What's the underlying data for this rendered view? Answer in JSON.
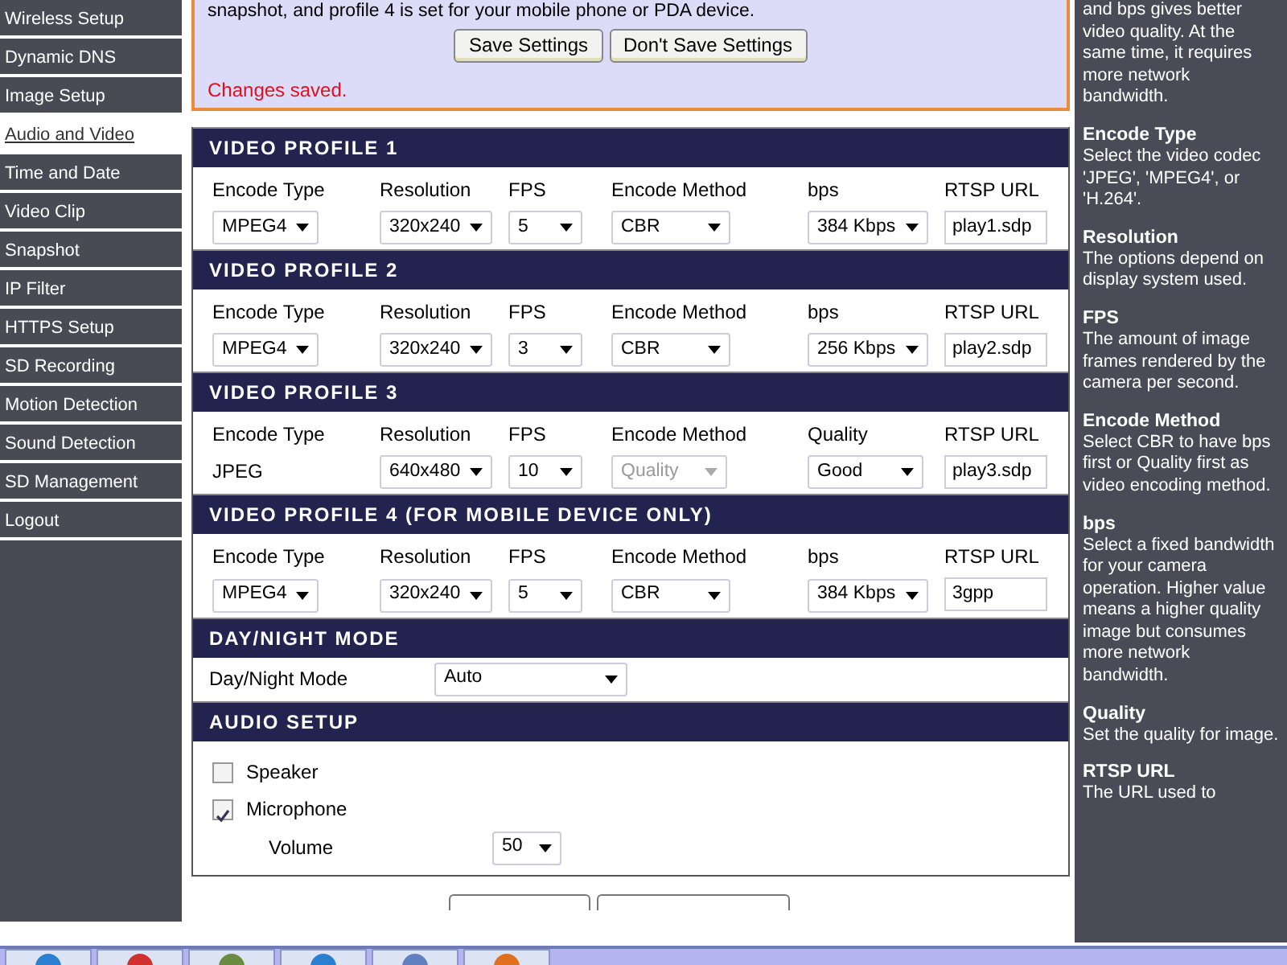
{
  "sidebar": {
    "items": [
      {
        "label": "Wireless Setup",
        "selected": false
      },
      {
        "label": "Dynamic DNS",
        "selected": false
      },
      {
        "label": "Image Setup",
        "selected": false
      },
      {
        "label": "Audio and Video",
        "selected": true
      },
      {
        "label": "Time and Date",
        "selected": false
      },
      {
        "label": "Video Clip",
        "selected": false
      },
      {
        "label": "Snapshot",
        "selected": false
      },
      {
        "label": "IP Filter",
        "selected": false
      },
      {
        "label": "HTTPS Setup",
        "selected": false
      },
      {
        "label": "SD Recording",
        "selected": false
      },
      {
        "label": "Motion Detection",
        "selected": false
      },
      {
        "label": "Sound Detection",
        "selected": false
      },
      {
        "label": "SD Management",
        "selected": false
      },
      {
        "label": "Logout",
        "selected": false
      }
    ]
  },
  "notice": {
    "text": "snapshot, and profile 4 is set for your mobile phone or PDA device.",
    "buttons": [
      "Save Settings",
      "Don't Save Settings"
    ],
    "status": "Changes saved."
  },
  "profiles": [
    {
      "title": "VIDEO PROFILE 1",
      "fields": [
        {
          "label": "Encode Type",
          "kind": "dropdown",
          "value": "MPEG4",
          "disabled": false
        },
        {
          "label": "Resolution",
          "kind": "dropdown",
          "value": "320x240",
          "disabled": false
        },
        {
          "label": "FPS",
          "kind": "dropdown",
          "value": "5",
          "disabled": false
        },
        {
          "label": "Encode Method",
          "kind": "dropdown",
          "value": "CBR",
          "disabled": false
        },
        {
          "label": "bps",
          "kind": "dropdown",
          "value": "384 Kbps",
          "disabled": false
        },
        {
          "label": "RTSP URL",
          "kind": "input",
          "value": "play1.sdp",
          "disabled": false
        }
      ]
    },
    {
      "title": "VIDEO PROFILE 2",
      "fields": [
        {
          "label": "Encode Type",
          "kind": "dropdown",
          "value": "MPEG4",
          "disabled": false
        },
        {
          "label": "Resolution",
          "kind": "dropdown",
          "value": "320x240",
          "disabled": false
        },
        {
          "label": "FPS",
          "kind": "dropdown",
          "value": "3",
          "disabled": false
        },
        {
          "label": "Encode Method",
          "kind": "dropdown",
          "value": "CBR",
          "disabled": false
        },
        {
          "label": "bps",
          "kind": "dropdown",
          "value": "256 Kbps",
          "disabled": false
        },
        {
          "label": "RTSP URL",
          "kind": "input",
          "value": "play2.sdp",
          "disabled": false
        }
      ]
    },
    {
      "title": "VIDEO PROFILE 3",
      "fields": [
        {
          "label": "Encode Type",
          "kind": "text",
          "value": "JPEG",
          "disabled": false
        },
        {
          "label": "Resolution",
          "kind": "dropdown",
          "value": "640x480",
          "disabled": false
        },
        {
          "label": "FPS",
          "kind": "dropdown",
          "value": "10",
          "disabled": false
        },
        {
          "label": "Encode Method",
          "kind": "dropdown",
          "value": "Quality",
          "disabled": true
        },
        {
          "label": "Quality",
          "kind": "dropdown",
          "value": "Good",
          "disabled": false
        },
        {
          "label": "RTSP URL",
          "kind": "input",
          "value": "play3.sdp",
          "disabled": false
        }
      ]
    },
    {
      "title": "VIDEO PROFILE 4 (FOR MOBILE DEVICE ONLY)",
      "fields": [
        {
          "label": "Encode Type",
          "kind": "dropdown",
          "value": "MPEG4",
          "disabled": false
        },
        {
          "label": "Resolution",
          "kind": "dropdown",
          "value": "320x240",
          "disabled": false
        },
        {
          "label": "FPS",
          "kind": "dropdown",
          "value": "5",
          "disabled": false
        },
        {
          "label": "Encode Method",
          "kind": "dropdown",
          "value": "CBR",
          "disabled": false
        },
        {
          "label": "bps",
          "kind": "dropdown",
          "value": "384 Kbps",
          "disabled": false
        },
        {
          "label": "RTSP URL",
          "kind": "input",
          "value": "3gpp",
          "disabled": false
        }
      ]
    }
  ],
  "day_night": {
    "title": "DAY/NIGHT MODE",
    "label": "Day/Night Mode",
    "value": "Auto"
  },
  "audio": {
    "title": "AUDIO SETUP",
    "options": [
      {
        "label": "Speaker",
        "checked": false
      },
      {
        "label": "Microphone",
        "checked": true
      }
    ],
    "volume": {
      "label": "Volume",
      "value": "50"
    }
  },
  "help": [
    {
      "text": "and bps gives better video quality. At the same time, it requires more network bandwidth."
    },
    {
      "heading": "Encode Type",
      "text": "Select the video codec 'JPEG', 'MPEG4', or 'H.264'."
    },
    {
      "heading": "Resolution",
      "text": "The options depend on display system used."
    },
    {
      "heading": "FPS",
      "text": "The amount of image frames rendered by the camera per second."
    },
    {
      "heading": "Encode Method",
      "text": "Select CBR to have bps first or Quality first as video encoding method."
    },
    {
      "heading": "bps",
      "text": "Select a fixed bandwidth for your camera operation. Higher value means a higher quality image but consumes more network bandwidth."
    },
    {
      "heading": "Quality",
      "text": "Set the quality for image."
    },
    {
      "heading": "RTSP URL",
      "text": "The URL used to"
    }
  ]
}
